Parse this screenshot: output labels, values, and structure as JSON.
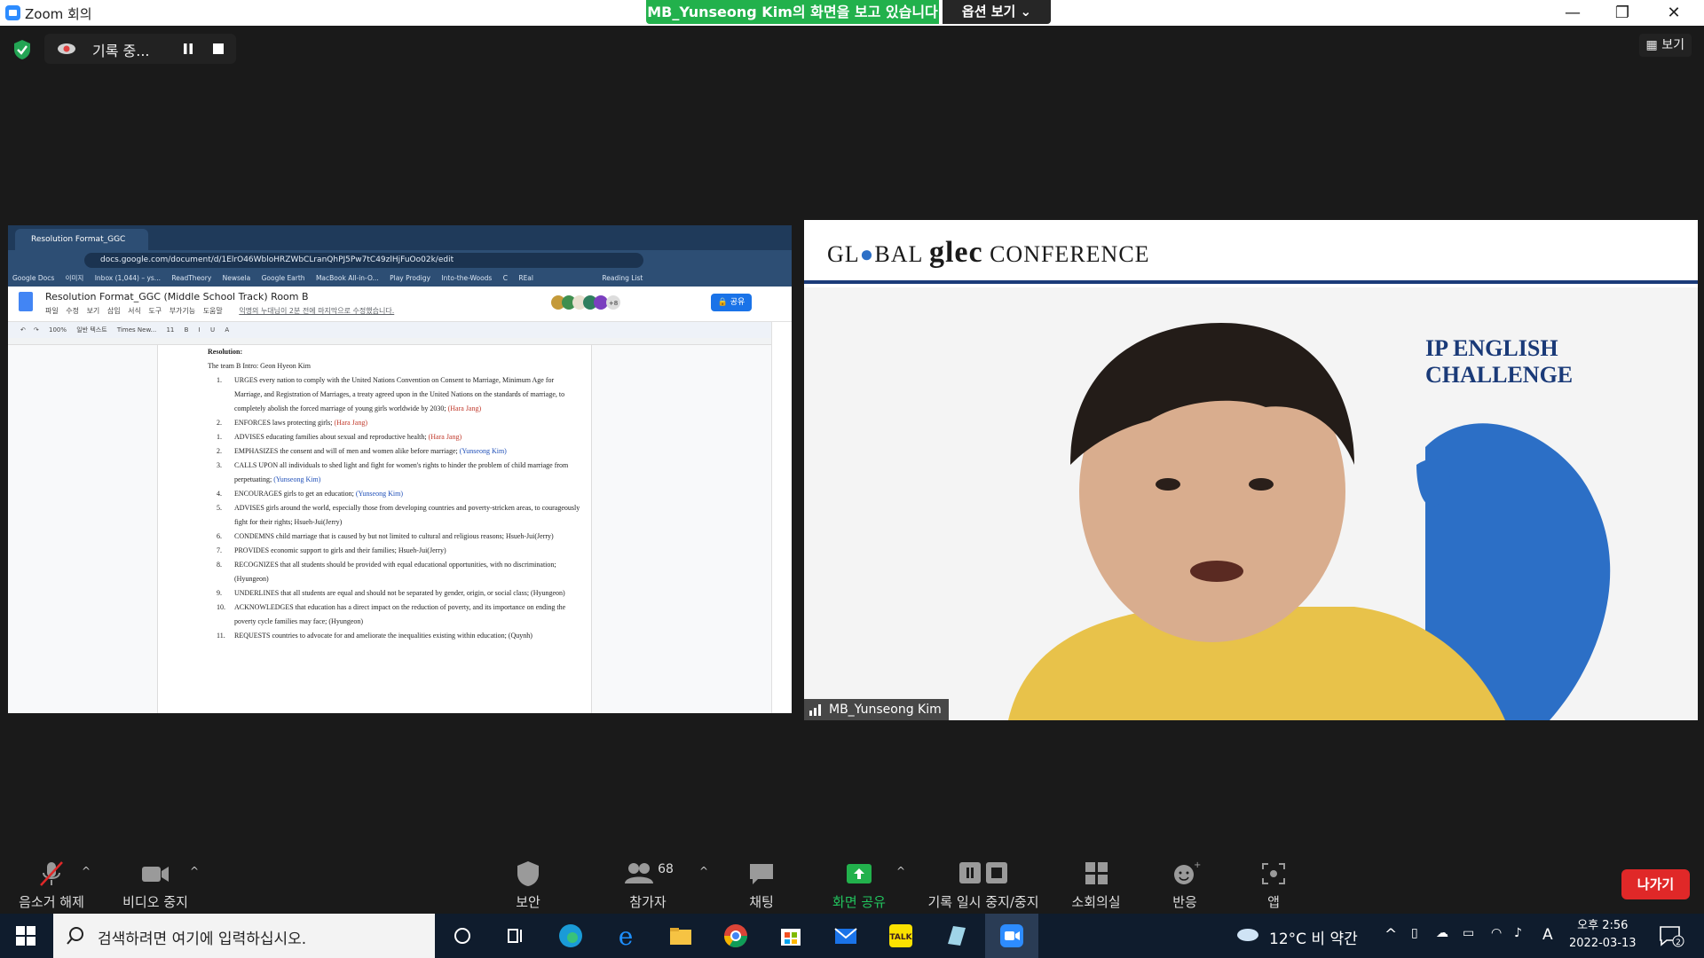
{
  "window": {
    "title": "Zoom 회의",
    "share_banner": "MB_Yunseong  Kim의 화면을 보고 있습니다",
    "view_options": "옵션 보기 ⌄",
    "minimize": "—",
    "restore": "❐",
    "close": "✕"
  },
  "recording": {
    "label": "기록 중..."
  },
  "view_button": "보기",
  "shared_screen": {
    "tab_title": "Resolution Format_GGC (Midd",
    "url": "docs.google.com/document/d/1ElrO46WbloHRZWbCLranQhPJ5Pw7tC49zlHjFuOo02k/edit",
    "bookmarks": [
      "Google Docs",
      "이미지",
      "Inbox (1,044) – ys...",
      "ReadTheory",
      "Newsela",
      "Google Earth",
      "MacBook All-in-O...",
      "Play Prodigy",
      "Into-the-Woods",
      "C",
      "REal",
      "Reading List"
    ],
    "doc_title": "Resolution Format_GGC (Middle School Track) Room B",
    "menus": [
      "파일",
      "수정",
      "보기",
      "삽입",
      "서식",
      "도구",
      "부가기능",
      "도움말"
    ],
    "last_edit": "익명의 누대님이 2분 전에 마지막으로 수정했습니다.",
    "share_label": "공유",
    "avatars_more": "+8",
    "toolbar": [
      "100%",
      "일반 텍스트",
      "Times New...",
      "11",
      "B",
      "I",
      "U",
      "A"
    ],
    "heading": "Resolution:",
    "intro": "The team B  Intro: Geon Hyeon Kim",
    "items": [
      {
        "num": "1.",
        "text": "URGES every nation to comply with the United Nations Convention on Consent to Marriage, Minimum Age for Marriage, and Registration of Marriages, a treaty agreed upon in the United Nations on the standards of marriage, to completely abolish the forced marriage of young girls worldwide by 2030;",
        "author": "(Hara Jang)",
        "color": "red"
      },
      {
        "num": "2.",
        "text": "ENFORCES laws protecting girls;",
        "author": "(Hara Jang)",
        "color": "red"
      },
      {
        "num": "1.",
        "text": "ADVISES educating families about sexual and reproductive health;",
        "author": "(Hara Jang)",
        "color": "red"
      },
      {
        "num": "2.",
        "text": "EMPHASIZES the consent and will of men and women alike before marriage;",
        "author": "(Yunseong Kim)",
        "color": "blue"
      },
      {
        "num": "3.",
        "text": "CALLS UPON all individuals to shed light and fight for women's rights to hinder the problem of child marriage from perpetuating;",
        "author": "(Yunseong Kim)",
        "color": "blue"
      },
      {
        "num": "4.",
        "text": "ENCOURAGES girls to get an education;",
        "author": "(Yunseong Kim)",
        "color": "blue"
      },
      {
        "num": "5.",
        "text": "ADVISES girls around the world, especially those from developing countries and poverty-stricken areas, to courageously fight for their rights; Hsueh-Jui(Jerry)",
        "author": "",
        "color": "none"
      },
      {
        "num": "6.",
        "text": "CONDEMNS child marriage that is caused by but not limited to cultural and religious reasons; Hsueh-Jui(Jerry)",
        "author": "",
        "color": "none"
      },
      {
        "num": "7.",
        "text": "PROVIDES economic support to girls and their families; Hsueh-Jui(Jerry)",
        "author": "",
        "color": "none"
      },
      {
        "num": "8.",
        "text": "RECOGNIZES that all students should be provided with equal educational opportunities, with no discrimination; (Hyungeon)",
        "author": "",
        "color": "none"
      },
      {
        "num": "9.",
        "text": "UNDERLINES that all students are equal and should not be separated by gender, origin, or social class; (Hyungeon)",
        "author": "",
        "color": "none"
      },
      {
        "num": "10.",
        "text": "ACKNOWLEDGES that education has a direct impact on the reduction of poverty, and its importance on ending the poverty cycle families may face; (Hyungeon)",
        "author": "",
        "color": "none"
      },
      {
        "num": "11.",
        "text": "REQUESTS countries to advocate for and ameliorate the inequalities existing within education; (Quynh)",
        "author": "",
        "color": "none"
      }
    ]
  },
  "video": {
    "banner_left": "GL",
    "banner_mid": "BAL",
    "banner_glec": "glec",
    "banner_right": "CONFERENCE",
    "arc_text": "IP ENGLISH CHALLENGE",
    "participant_name": "MB_Yunseong Kim"
  },
  "toolbar": {
    "mute": "음소거 해제",
    "video": "비디오 중지",
    "security": "보안",
    "participants": "참가자",
    "participants_count": "68",
    "chat": "채팅",
    "share": "화면 공유",
    "record": "기록 일시 중지/중지",
    "breakout": "소회의실",
    "reactions": "반응",
    "apps": "앱",
    "leave": "나가기"
  },
  "taskbar": {
    "search_placeholder": "검색하려면 여기에 입력하십시오.",
    "weather": "12°C  비 약간",
    "ime": "A",
    "time_period": "오후 2:56",
    "date": "2022-03-13",
    "notifications": "2"
  },
  "colors": {
    "zoom_green": "#22b14c",
    "leave_red": "#e02828",
    "taskbar": "#0f1c2d"
  }
}
